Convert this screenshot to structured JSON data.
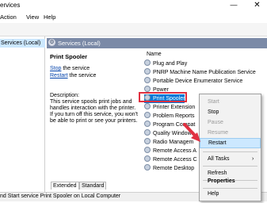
{
  "window": {
    "title": "ervices",
    "min_glyph": "—",
    "close_glyph": "✕"
  },
  "menu": [
    "Action",
    "View",
    "Help"
  ],
  "tree": {
    "selected": "Services (Local)"
  },
  "panel": {
    "title": "Services (Local)"
  },
  "details": {
    "service_name": "Print Spooler",
    "stop_link": "Stop",
    "stop_suffix": " the service",
    "restart_link": "Restart",
    "restart_suffix": " the service",
    "description_heading": "Description:",
    "description_lines": [
      "This service spools print jobs and",
      "handles interaction with the printer.",
      "If you turn off this service, you won't",
      "be able to print or see your printers."
    ]
  },
  "list": {
    "column": "Name",
    "rows": [
      "Plug and Play",
      "PNRP Machine Name Publication Service",
      "Portable Device Enumerator Service",
      "Power",
      "Print Spooler",
      "Printer Extension",
      "Problem Reports",
      "Program Compat",
      "Quality Windows",
      "Radio Managem",
      "Remote Access A",
      "Remote Access C",
      "Remote Desktop"
    ],
    "selected_index": 4
  },
  "tabs": [
    "Extended",
    "Standard"
  ],
  "status": "nd Start service Print Spooler on Local Computer",
  "context_menu": {
    "start": "Start",
    "stop": "Stop",
    "pause": "Pause",
    "resume": "Resume",
    "restart": "Restart",
    "all_tasks": "All Tasks",
    "all_tasks_arrow": "›",
    "refresh": "Refresh",
    "properties": "Properties",
    "help": "Help"
  },
  "colors": {
    "highlight": "#0078d7",
    "annotation": "#e03040",
    "panel_header": "#7b8aa7"
  }
}
